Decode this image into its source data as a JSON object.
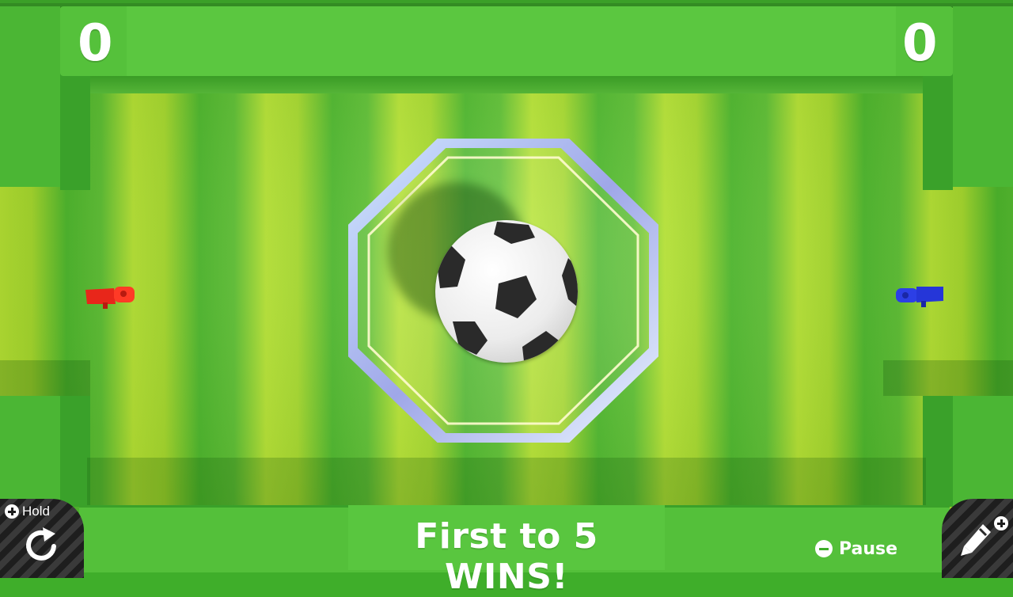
{
  "scoreboard": {
    "left_score": "0",
    "right_score": "0"
  },
  "players": {
    "left": {
      "color": "#e8261a",
      "icon": "red-player-car-icon"
    },
    "right": {
      "color": "#2536d8",
      "icon": "blue-player-car-icon"
    }
  },
  "ball": {
    "icon": "soccer-ball-icon"
  },
  "goal_banner": {
    "text": "First to 5 WINS!"
  },
  "controls": {
    "hold_label": "Hold",
    "hold_icon": "rotate-icon",
    "pause_label": "Pause",
    "pause_icon": "minus-button-icon",
    "edit_icon": "pencil-icon"
  },
  "colors": {
    "field_light": "#b7e534",
    "field_dark": "#4fba2d",
    "wall": "#49b234"
  }
}
